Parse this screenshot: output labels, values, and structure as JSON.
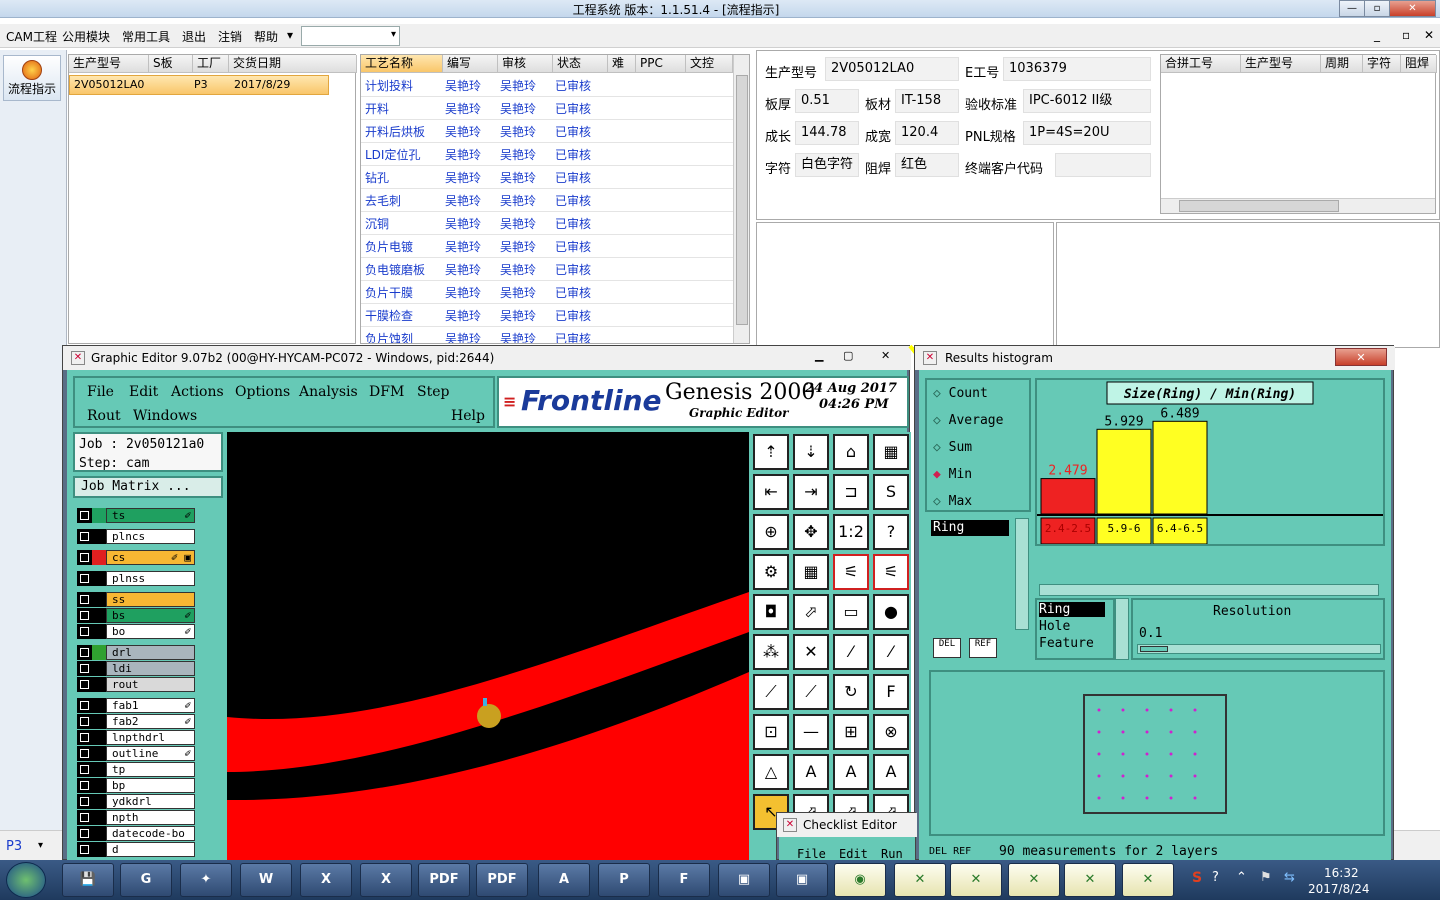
{
  "window": {
    "title": "工程系统    版本：1.1.51.4 - [流程指示]",
    "min": "—",
    "max": "▫",
    "close": "✕"
  },
  "menu": {
    "items": [
      "CAM工程",
      "公用模块",
      "常用工具",
      "退出",
      "注销",
      "帮助"
    ],
    "help_arrow": "▾",
    "combo_value": ""
  },
  "mdi": {
    "min": "_",
    "restore": "▫",
    "close": "✕"
  },
  "sidebar": {
    "button_label": "流程指示"
  },
  "jobs": {
    "headers": [
      "生产型号",
      "S板",
      "工厂",
      "交货日期"
    ],
    "rows": [
      {
        "model": "2V05012LA0",
        "s": "",
        "factory": "P3",
        "date": "2017/8/29"
      }
    ]
  },
  "process": {
    "headers": [
      "工艺名称",
      "编写",
      "审核",
      "状态",
      "难",
      "PPC",
      "文控"
    ],
    "rows": [
      {
        "name": "计划投料",
        "w": "吴艳玲",
        "r": "吴艳玲",
        "s": "已审核"
      },
      {
        "name": "开料",
        "w": "吴艳玲",
        "r": "吴艳玲",
        "s": "已审核"
      },
      {
        "name": "开料后烘板",
        "w": "吴艳玲",
        "r": "吴艳玲",
        "s": "已审核"
      },
      {
        "name": "LDI定位孔",
        "w": "吴艳玲",
        "r": "吴艳玲",
        "s": "已审核"
      },
      {
        "name": "钻孔",
        "w": "吴艳玲",
        "r": "吴艳玲",
        "s": "已审核"
      },
      {
        "name": "去毛刺",
        "w": "吴艳玲",
        "r": "吴艳玲",
        "s": "已审核"
      },
      {
        "name": "沉铜",
        "w": "吴艳玲",
        "r": "吴艳玲",
        "s": "已审核"
      },
      {
        "name": "负片电镀",
        "w": "吴艳玲",
        "r": "吴艳玲",
        "s": "已审核"
      },
      {
        "name": "负电镀磨板",
        "w": "吴艳玲",
        "r": "吴艳玲",
        "s": "已审核"
      },
      {
        "name": "负片干膜",
        "w": "吴艳玲",
        "r": "吴艳玲",
        "s": "已审核"
      },
      {
        "name": "干膜检查",
        "w": "吴艳玲",
        "r": "吴艳玲",
        "s": "已审核"
      },
      {
        "name": "负片蚀刻",
        "w": "吴艳玲",
        "r": "吴艳玲",
        "s": "已审核"
      }
    ]
  },
  "info": {
    "model_label": "生产型号",
    "model": "2V05012LA0",
    "eno_label": "E工号",
    "eno": "1036379",
    "thick_label": "板厚",
    "thick": "0.51",
    "mat_label": "板材",
    "mat": "IT-158",
    "std_label": "验收标准",
    "std": "IPC-6012 II级",
    "len_label": "成长",
    "len": "144.78",
    "wid_label": "成宽",
    "wid": "120.4",
    "pnl_label": "PNL规格",
    "pnl": "1P=4S=20U",
    "char_label": "字符",
    "char": "白色字符",
    "mask_label": "阻焊",
    "mask": "红色",
    "cust_label": "终端客户代码",
    "cust": ""
  },
  "combine": {
    "headers": [
      "合拼工号",
      "生产型号",
      "周期",
      "字符",
      "阻焊"
    ]
  },
  "bottom": {
    "factory": "P3"
  },
  "editor": {
    "title": "Graphic Editor 9.07b2 (00@HY-HYCAM-PC072 - Windows, pid:2644)",
    "menu": [
      "File",
      "Edit",
      "Actions",
      "Options",
      "Analysis",
      "DFM",
      "Step",
      "Rout",
      "Windows",
      "Help"
    ],
    "brand": "Frontline",
    "product": "Genesis 2000",
    "subtitle": "Graphic Editor",
    "date": "24 Aug 2017",
    "time": "04:26 PM",
    "job_label": "Job : 2v050121a0",
    "step_label": "Step: cam",
    "job_matrix": "Job Matrix ...",
    "layers": [
      {
        "name": "ts",
        "color": "#1fa060",
        "swatch": "#1fa060",
        "mark": "✐"
      },
      {
        "name": "plncs",
        "color": "#ffffff",
        "swatch": "#000000",
        "mark": ""
      },
      {
        "name": "cs",
        "color": "#f7b733",
        "swatch": "#e02020",
        "mark": "✐ ▣"
      },
      {
        "name": "plnss",
        "color": "#ffffff",
        "swatch": "#000000",
        "mark": ""
      },
      {
        "name": "ss",
        "color": "#f7b733",
        "swatch": "#000000",
        "mark": ""
      },
      {
        "name": "bs",
        "color": "#1fa060",
        "swatch": "#000000",
        "mark": "✐"
      },
      {
        "name": "bo",
        "color": "#ffffff",
        "swatch": "#000000",
        "mark": "✐"
      },
      {
        "name": "drl",
        "color": "#a9b5bd",
        "swatch": "#30a030",
        "mark": ""
      },
      {
        "name": "ldi",
        "color": "#a9b5bd",
        "swatch": "#000000",
        "mark": ""
      },
      {
        "name": "rout",
        "color": "#d9d9d9",
        "swatch": "#000000",
        "mark": ""
      },
      {
        "name": "fab1",
        "color": "#ffffff",
        "swatch": "#000000",
        "mark": "✐"
      },
      {
        "name": "fab2",
        "color": "#ffffff",
        "swatch": "#000000",
        "mark": "✐"
      },
      {
        "name": "lnpthdrl",
        "color": "#ffffff",
        "swatch": "#000000",
        "mark": ""
      },
      {
        "name": "outline",
        "color": "#ffffff",
        "swatch": "#000000",
        "mark": "✐"
      },
      {
        "name": "tp",
        "color": "#ffffff",
        "swatch": "#000000",
        "mark": ""
      },
      {
        "name": "bp",
        "color": "#ffffff",
        "swatch": "#000000",
        "mark": ""
      },
      {
        "name": "ydkdrl",
        "color": "#ffffff",
        "swatch": "#000000",
        "mark": ""
      },
      {
        "name": "npth",
        "color": "#ffffff",
        "swatch": "#000000",
        "mark": ""
      },
      {
        "name": "datecode-bo",
        "color": "#ffffff",
        "swatch": "#000000",
        "mark": ""
      },
      {
        "name": "d",
        "color": "#ffffff",
        "swatch": "#000000",
        "mark": ""
      }
    ],
    "tools": [
      "⇡",
      "⇣",
      "⌂",
      "▦",
      "⇤",
      "⇥",
      "⊐",
      "S",
      "⊕",
      "✥",
      "1:2",
      "?",
      "⚙",
      "▦",
      "⚟",
      "⚟",
      "◘",
      "⬀",
      "▭",
      "●",
      "⁂",
      "✕",
      "⁄",
      "⁄",
      "⟋",
      "⟋",
      "↻",
      "F",
      "⊡",
      "—",
      "⊞",
      "⊗",
      "△",
      "A",
      "A",
      "A",
      "↖",
      "⬀",
      "⬀",
      "⬀"
    ]
  },
  "histogram": {
    "title": "Results histogram",
    "modes": [
      "Count",
      "Average",
      "Sum",
      "Min",
      "Max"
    ],
    "selected_mode": "Min",
    "chart_title": "Size(Ring) / Min(Ring)",
    "ring_label": "Ring",
    "list": [
      "Ring",
      "Hole",
      "Feature"
    ],
    "resolution_label": "Resolution",
    "resolution_value": "0.1",
    "del": "DEL",
    "ref": "REF",
    "status": "90 measurements for 2 layers",
    "checklist": "Checklist Editor",
    "checklist_menu": [
      "File",
      "Edit",
      "Run"
    ]
  },
  "chart_data": {
    "type": "bar",
    "categories": [
      "2.4-2.5",
      "5.9-6",
      "6.4-6.5"
    ],
    "values": [
      2.479,
      5.929,
      6.489
    ],
    "title": "Size(Ring) / Min(Ring)",
    "colors": [
      "#ee2222",
      "#ffff22",
      "#ffff22"
    ],
    "ylim": [
      0,
      7
    ]
  },
  "taskbar": {
    "time": "16:32",
    "date": "2017/8/24",
    "apps": [
      "start",
      "save",
      "ie",
      "shell",
      "word",
      "excel",
      "excel2",
      "pdf",
      "pdf2",
      "doc",
      "pad",
      "flag",
      "screen",
      "screen2",
      "genesis",
      "x1",
      "x2",
      "x3",
      "x4",
      "x5"
    ]
  }
}
